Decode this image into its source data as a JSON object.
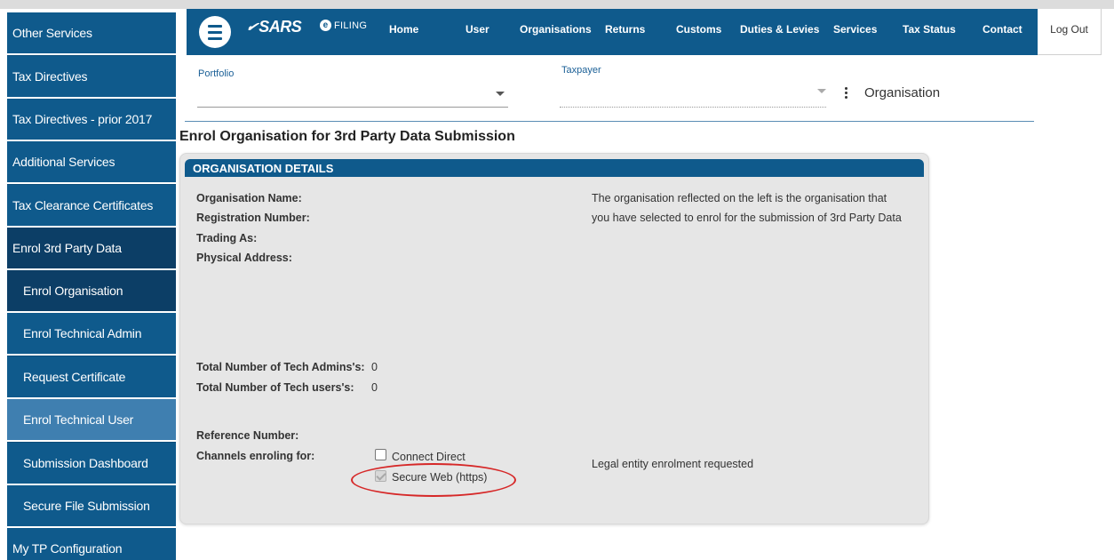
{
  "header": {
    "brand": "SARS",
    "sub_brand": "FILING",
    "nav": [
      "Home",
      "User",
      "Organisations",
      "Returns",
      "Customs",
      "Duties & Levies",
      "Services",
      "Tax Status",
      "Contact"
    ],
    "logout": "Log Out"
  },
  "sidebar": {
    "items": [
      "Other Services",
      "Tax Directives",
      "Tax Directives - prior 2017",
      "Additional Services",
      "Tax Clearance Certificates",
      "Enrol 3rd Party Data",
      "Enrol Organisation",
      "Enrol Technical Admin",
      "Request Certificate",
      "Enrol Technical User",
      "Submission Dashboard",
      "Secure File Submission",
      "My TP Configuration"
    ]
  },
  "selectors": {
    "portfolio_label": "Portfolio",
    "portfolio_value": "",
    "taxpayer_label": "Taxpayer",
    "taxpayer_value": "",
    "context": "Organisation"
  },
  "page": {
    "title": "Enrol Organisation for 3rd Party Data Submission",
    "section_title": "ORGANISATION DETAILS",
    "fields": {
      "org_name_label": "Organisation Name:",
      "reg_number_label": "Registration Number:",
      "trading_as_label": "Trading As:",
      "physical_address_label": "Physical Address:",
      "tech_admins_label": "Total Number of Tech Admins's:",
      "tech_admins_value": "0",
      "tech_users_label": "Total Number of Tech users's:",
      "tech_users_value": "0",
      "reference_label": "Reference Number:",
      "channels_label": "Channels enroling for:"
    },
    "note_line1": "The organisation reflected on the left is the organisation that",
    "note_line2": "you have selected to enrol for the submission of 3rd Party Data",
    "channels": [
      {
        "label": "Connect Direct",
        "checked": false
      },
      {
        "label": "Secure Web (https)",
        "checked": true
      }
    ],
    "status": "Legal entity enrolment requested"
  },
  "colors": {
    "primary": "#0f5a8c",
    "sidebar_dark": "#0c3e66",
    "sidebar_active": "#3f7fb0",
    "highlight": "#d62828"
  }
}
